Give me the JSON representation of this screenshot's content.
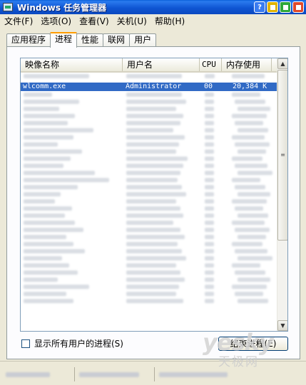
{
  "window": {
    "title": "Windows 任务管理器",
    "help_glyph": "?"
  },
  "menu": [
    {
      "label": "文件(F)"
    },
    {
      "label": "选项(O)"
    },
    {
      "label": "查看(V)"
    },
    {
      "label": "关机(U)"
    },
    {
      "label": "帮助(H)"
    }
  ],
  "tabs": [
    {
      "label": "应用程序"
    },
    {
      "label": "进程",
      "active": true
    },
    {
      "label": "性能"
    },
    {
      "label": "联网"
    },
    {
      "label": "用户"
    }
  ],
  "process_list": {
    "columns": [
      "映像名称",
      "用户名",
      "CPU",
      "内存使用"
    ],
    "selected_row": {
      "image": "wlcomm.exe",
      "user": "Administrator",
      "cpu": "00",
      "mem": "20,384 K"
    }
  },
  "options": {
    "show_all_users_label": "显示所有用户的进程(S)",
    "show_all_users_checked": false
  },
  "actions": {
    "end_process_label": "结束进程(E)"
  },
  "watermark": {
    "logo": "yesky",
    "sub": "天极网"
  },
  "icons": {
    "app_icon": "task-manager-icon",
    "help": "help-icon",
    "minimize": "minimize-icon",
    "maximize": "maximize-icon",
    "close": "close-icon"
  }
}
